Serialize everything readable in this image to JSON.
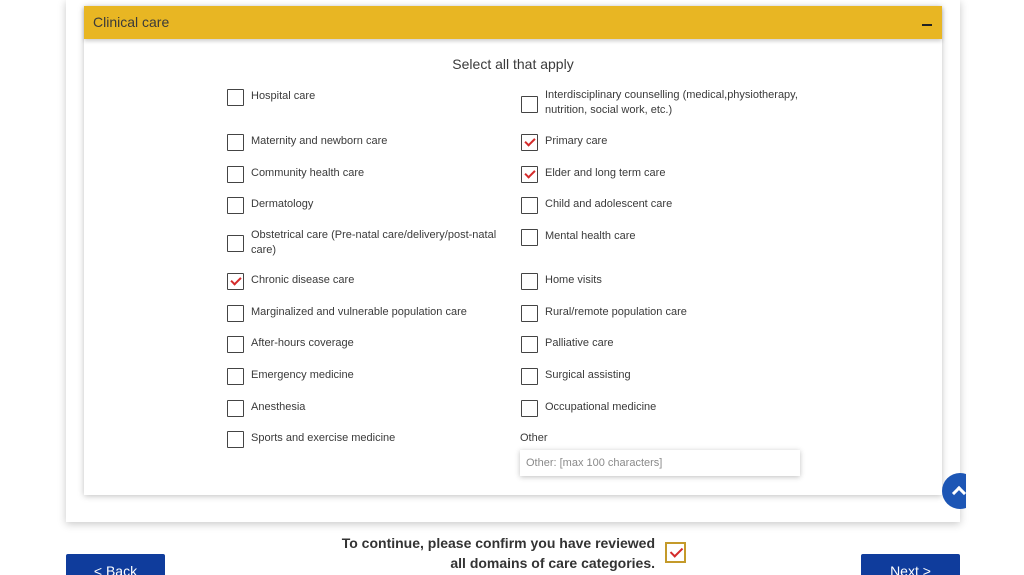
{
  "section": {
    "title": "Clinical care",
    "instruction": "Select all that apply"
  },
  "options_left": [
    {
      "label": "Hospital care",
      "checked": false
    },
    {
      "label": "Maternity and newborn care",
      "checked": false
    },
    {
      "label": "Community health care",
      "checked": false
    },
    {
      "label": "Dermatology",
      "checked": false
    },
    {
      "label": "Obstetrical care (Pre-natal care/delivery/post-natal care)",
      "checked": false
    },
    {
      "label": "Chronic disease care",
      "checked": true
    },
    {
      "label": "Marginalized and vulnerable population care",
      "checked": false
    },
    {
      "label": "After-hours coverage",
      "checked": false
    },
    {
      "label": "Emergency medicine",
      "checked": false
    },
    {
      "label": "Anesthesia",
      "checked": false
    },
    {
      "label": "Sports and exercise medicine",
      "checked": false
    }
  ],
  "options_right": [
    {
      "label": "Interdisciplinary counselling (medical,physiotherapy, nutrition, social work, etc.)",
      "checked": false
    },
    {
      "label": "Primary care",
      "checked": true
    },
    {
      "label": "Elder and long term care",
      "checked": true
    },
    {
      "label": "Child and adolescent care",
      "checked": false
    },
    {
      "label": "Mental health care",
      "checked": false
    },
    {
      "label": "Home visits",
      "checked": false
    },
    {
      "label": "Rural/remote population care",
      "checked": false
    },
    {
      "label": "Palliative care",
      "checked": false
    },
    {
      "label": "Surgical assisting",
      "checked": false
    },
    {
      "label": "Occupational medicine",
      "checked": false
    }
  ],
  "other": {
    "label": "Other",
    "placeholder": "Other: [max 100 characters]",
    "value": ""
  },
  "confirm": {
    "line1": "To continue, please confirm you have reviewed",
    "line2": "all domains of care categories.",
    "checked": true
  },
  "nav": {
    "back_label": "< Back",
    "next_label": "Next >"
  },
  "colors": {
    "header_bg": "#e8b623",
    "check_mark": "#d42b2b",
    "button_bg": "#0f3c9c",
    "scroll_top_bg": "#1d56b5"
  }
}
